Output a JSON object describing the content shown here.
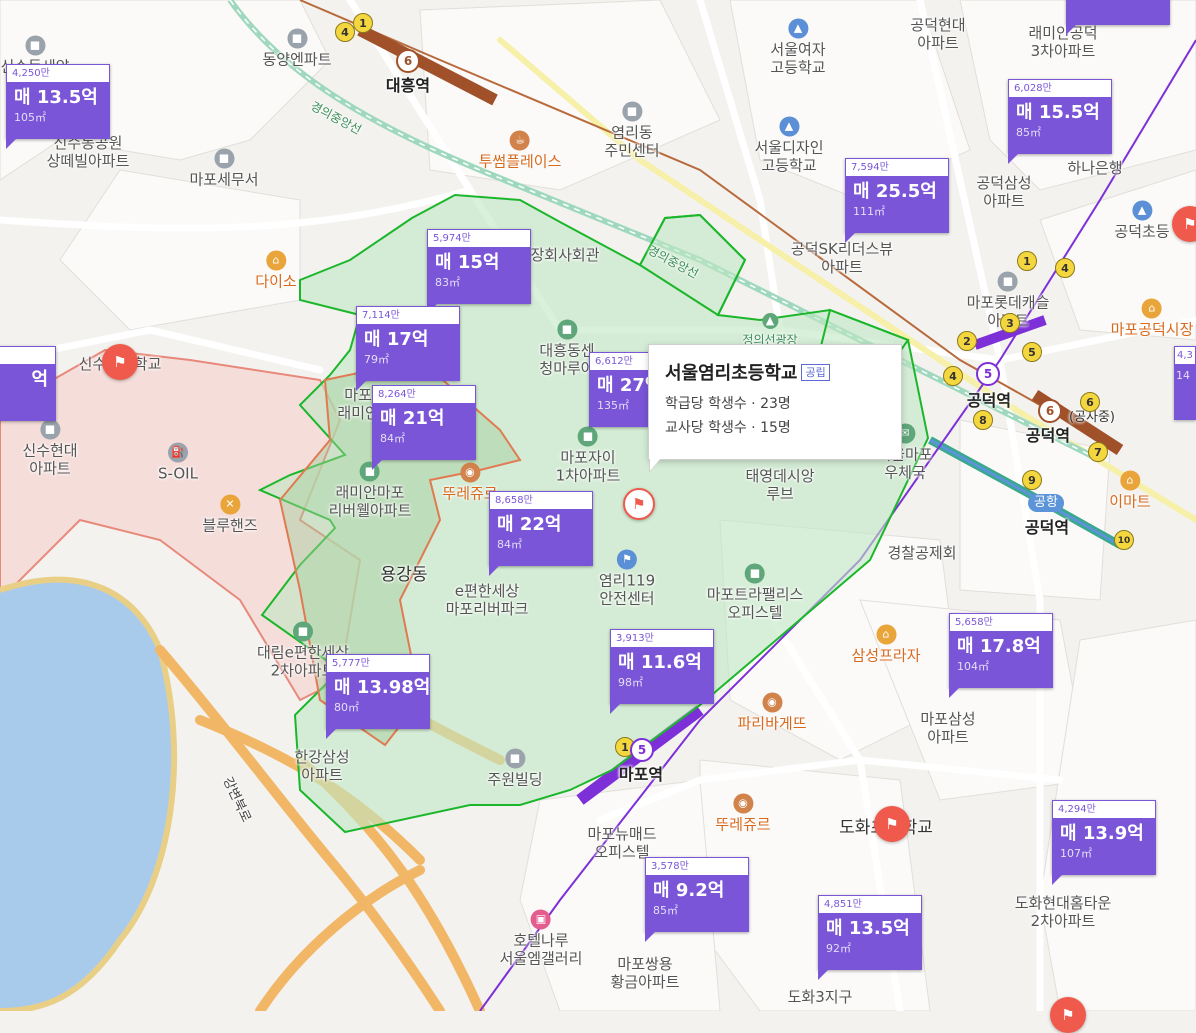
{
  "colors": {
    "price_marker": "#7a55d8",
    "school_zone": "#1cb62b",
    "school_icon": "#ef5a4c",
    "line6": "#a0512a",
    "line5": "#7d2fd8"
  },
  "popup": {
    "title": "서울염리초등학교",
    "badge": "공립",
    "row1": "학급당 학생수 · 23명",
    "row2": "교사당 학생수 · 15명"
  },
  "price_markers": [
    {
      "price_per": "4,250만",
      "value": "매 13.5억",
      "size": "105㎡"
    },
    {
      "price_per": "6,028만",
      "value": "매 15.5억",
      "size": "85㎡"
    },
    {
      "price_per": "7,594만",
      "value": "매 25.5억",
      "size": "111㎡"
    },
    {
      "price_per": "5,974만",
      "value": "매 15억",
      "size": "83㎡"
    },
    {
      "price_per": "7,114만",
      "value": "매 17억",
      "size": "79㎡"
    },
    {
      "price_per": "8,264만",
      "value": "매 21억",
      "size": "84㎡"
    },
    {
      "price_per": "6,612만",
      "value": "매 27억",
      "size": "135㎡"
    },
    {
      "price_per": "8,658만",
      "value": "매 22억",
      "size": "84㎡"
    },
    {
      "price_per": "5,777만",
      "value": "매 13.98억",
      "size": "80㎡"
    },
    {
      "price_per": "3,913만",
      "value": "매 11.6억",
      "size": "98㎡"
    },
    {
      "price_per": "5,658만",
      "value": "매 17.8억",
      "size": "104㎡"
    },
    {
      "price_per": "4,294만",
      "value": "매 13.9억",
      "size": "107㎡"
    },
    {
      "price_per": "3,578만",
      "value": "매 9.2억",
      "size": "85㎡"
    },
    {
      "price_per": "4,851만",
      "value": "매 13.5억",
      "size": "92㎡"
    },
    {
      "price_per": "",
      "value": "억",
      "size": ""
    },
    {
      "price_per": "4,3",
      "value": "",
      "size": "14"
    }
  ],
  "places": [
    {
      "text": "신수동세양",
      "icon": "building"
    },
    {
      "text": "동양엔파트",
      "icon": "building"
    },
    {
      "text": "대흥역",
      "icon": ""
    },
    {
      "text": "서울여자\n고등학교",
      "icon": "school"
    },
    {
      "text": "공덕현대\n아파트",
      "icon": ""
    },
    {
      "text": "래미안공덕\n3차아파트",
      "icon": ""
    },
    {
      "text": "신수동공원\n상떼빌아파트",
      "icon": ""
    },
    {
      "text": "마포세무서",
      "icon": "building"
    },
    {
      "text": "염리동\n주민센터",
      "icon": "building"
    },
    {
      "text": "투썸플레이스",
      "icon": "cafe"
    },
    {
      "text": "서울디자인\n고등학교",
      "icon": "school"
    },
    {
      "text": "공덕삼성\n아파트",
      "icon": ""
    },
    {
      "text": "하나은행",
      "icon": ""
    },
    {
      "text": "공덕초등",
      "icon": "school"
    },
    {
      "text": "다이소",
      "icon": "shop"
    },
    {
      "text": "장회사회관",
      "icon": "building"
    },
    {
      "text": "공덕SK리더스뷰\n아파트",
      "icon": "building"
    },
    {
      "text": "마포롯데캐슬\n아파트",
      "icon": "building"
    },
    {
      "text": "마포공덕시장",
      "icon": "shop"
    },
    {
      "text": "신수초등학교",
      "icon": ""
    },
    {
      "text": "대흥동센\n청마루아",
      "icon": "building"
    },
    {
      "text": "신수현대\n아파트",
      "icon": "building"
    },
    {
      "text": "마포용\n래미안아",
      "icon": "building"
    },
    {
      "text": "S-OIL",
      "icon": "gas"
    },
    {
      "text": "마포자이\n1차아파트",
      "icon": "building"
    },
    {
      "text": "태영데시앙\n루브",
      "icon": ""
    },
    {
      "text": "서울마포\n우체국",
      "icon": "post"
    },
    {
      "text": "래미안마포\n리버웰아파트",
      "icon": ""
    },
    {
      "text": "뚜레쥬르",
      "icon": "bakery"
    },
    {
      "text": "블루핸즈",
      "icon": "repair"
    },
    {
      "text": "공덕역",
      "icon": ""
    },
    {
      "text": "공덕역",
      "icon": ""
    },
    {
      "text": "공덕역",
      "icon": ""
    },
    {
      "text": "이마트",
      "icon": "shop"
    },
    {
      "text": "경찰공제회",
      "icon": ""
    },
    {
      "text": "용강동",
      "icon": ""
    },
    {
      "text": "e편한세상\n마포리버파크",
      "icon": ""
    },
    {
      "text": "염리119\n안전센터",
      "icon": "fire"
    },
    {
      "text": "마포트라팰리스\n오피스텔",
      "icon": "building"
    },
    {
      "text": "삼성프라자",
      "icon": "shop"
    },
    {
      "text": "대림e편한세상\n2차아파트",
      "icon": "building"
    },
    {
      "text": "파리바게뜨",
      "icon": "bakery"
    },
    {
      "text": "마포삼성\n아파트",
      "icon": ""
    },
    {
      "text": "한강삼성\n아파트",
      "icon": ""
    },
    {
      "text": "주원빌딩",
      "icon": "building"
    },
    {
      "text": "마포역",
      "icon": ""
    },
    {
      "text": "뚜레쥬르",
      "icon": "bakery"
    },
    {
      "text": "도화초등학교",
      "icon": ""
    },
    {
      "text": "마포뉴매드\n오피스텔",
      "icon": ""
    },
    {
      "text": "도화현대홈타운\n2차아파트",
      "icon": ""
    },
    {
      "text": "호텔나루\n서울엠갤러리",
      "icon": "hotel"
    },
    {
      "text": "마포쌍용\n황금아파트",
      "icon": ""
    },
    {
      "text": "도화3지구",
      "icon": ""
    },
    {
      "text": "강변북로",
      "icon": ""
    },
    {
      "text": "경의중앙선",
      "icon": ""
    },
    {
      "text": "경의중앙선",
      "icon": ""
    },
    {
      "text": "공항",
      "icon": ""
    },
    {
      "text": "(공사중)",
      "icon": ""
    },
    {
      "text": "정의선광장",
      "icon": "park"
    }
  ],
  "station_badges": [
    "1",
    "4",
    "6",
    "1",
    "4",
    "2",
    "3",
    "5",
    "4",
    "5",
    "6",
    "7",
    "8",
    "9",
    "10",
    "1",
    "5",
    "6"
  ]
}
